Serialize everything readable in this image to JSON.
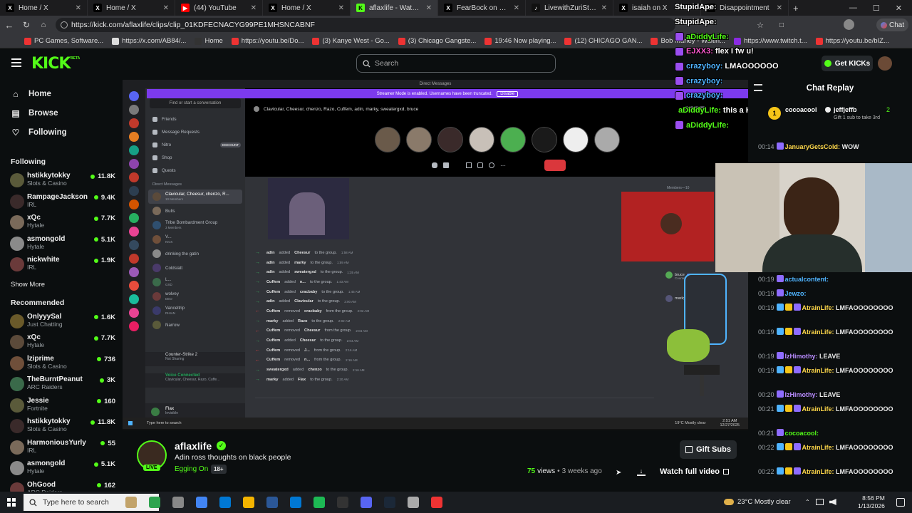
{
  "browser": {
    "tabs": [
      {
        "label": "Home / X",
        "icon": "x-logo-icon"
      },
      {
        "label": "Home / X",
        "icon": "x-logo-icon"
      },
      {
        "label": "(44) YouTube",
        "icon": "youtube-icon"
      },
      {
        "label": "Home / X",
        "icon": "x-logo-icon"
      },
      {
        "label": "aflaxlife - Watch clips o",
        "icon": "kick-icon"
      },
      {
        "label": "FearBock on X: \"LMAO t",
        "icon": "x-logo-icon"
      },
      {
        "label": "LivewithZuriStarr (@live",
        "icon": "tiktok-icon"
      },
      {
        "label": "isaiah on X",
        "icon": "x-logo-icon"
      },
      {
        "label": "Disappointment",
        "icon": "x-logo-icon"
      }
    ],
    "url": "https://kick.com/aflaxlife/clips/clip_01KDFECNACYG99PE1MHSNCABNF",
    "profile_label": "Chat",
    "bookmarks": [
      "PC Games, Software...",
      "https://x.com/AB84/...",
      "Home",
      "https://youtu.be/Do...",
      "(3) Kanye West - Go...",
      "(3) Chicago Gangste...",
      "19:46 Now playing...",
      "(12) CHICAGO GAN...",
      "Bob Marley - Waitin...",
      "https://www.twitch.t...",
      "https://youtu.be/bIZ..."
    ]
  },
  "header": {
    "logo": "KICK",
    "logo_beta": "BETA",
    "search_placeholder": "Search",
    "get_kicks": "Get KICKs",
    "accent": "#53fc18"
  },
  "sidebar": {
    "nav": [
      {
        "label": "Home",
        "icon": "home-icon"
      },
      {
        "label": "Browse",
        "icon": "browse-icon"
      },
      {
        "label": "Following",
        "icon": "heart-icon"
      }
    ],
    "following_title": "Following",
    "following": [
      {
        "name": "hstikkytokky",
        "category": "Slots & Casino",
        "viewers": "11.8K"
      },
      {
        "name": "RampageJackson",
        "category": "IRL",
        "viewers": "9.4K"
      },
      {
        "name": "xQc",
        "category": "Hytale",
        "viewers": "7.7K"
      },
      {
        "name": "asmongold",
        "category": "Hytale",
        "viewers": "5.1K"
      },
      {
        "name": "nickwhite",
        "category": "IRL",
        "viewers": "1.9K"
      }
    ],
    "show_more": "Show More",
    "recommended_title": "Recommended",
    "recommended": [
      {
        "name": "OnlyyySal",
        "category": "Just Chatting",
        "viewers": "1.6K"
      },
      {
        "name": "xQc",
        "category": "Hytale",
        "viewers": "7.7K"
      },
      {
        "name": "lziprime",
        "category": "Slots & Casino",
        "viewers": "736"
      },
      {
        "name": "TheBurntPeanut",
        "category": "ARC Raiders",
        "viewers": "3K"
      },
      {
        "name": "Jessie",
        "category": "Fortnite",
        "viewers": "160"
      },
      {
        "name": "hstikkytokky",
        "category": "Slots & Casino",
        "viewers": "11.8K"
      },
      {
        "name": "HarmoniousYurly",
        "category": "IRL",
        "viewers": "55"
      },
      {
        "name": "asmongold",
        "category": "Hytale",
        "viewers": "5.1K"
      },
      {
        "name": "OhGood",
        "category": "ARC Raiders",
        "viewers": "162"
      }
    ]
  },
  "video": {
    "title_bar": "Direct Messages",
    "banner": "Streamer Mode is enabled. Usernames have been truncated.",
    "banner_btn": "Disable",
    "find_conv": "Find or start a conversation",
    "dm_header": "Clavicular, Cheesur, chenzo, Razo, Cuffem, adin, marky, sweatergxd, bruce",
    "enabled_badge": "ENABLED",
    "dm_nav": [
      "Friends",
      "Message Requests",
      "Nitro",
      "Shop",
      "Quests"
    ],
    "nitro_badge": "DISCOUNT",
    "dm_section": "Direct Messages",
    "dm_list": [
      {
        "name": "Clavicular, Cheesur, chenzo, R...",
        "sub": "10 Members"
      },
      {
        "name": "Bulls",
        "sub": ""
      },
      {
        "name": "Tribe Bombardment Group",
        "sub": "3 Members"
      },
      {
        "name": "V...",
        "sub": "KICK"
      },
      {
        "name": "drinking the gatin",
        "sub": ""
      },
      {
        "name": "Coldslatt",
        "sub": ""
      },
      {
        "name": "L...",
        "sub": "GXD"
      },
      {
        "name": "wolvey",
        "sub": "DEO"
      },
      {
        "name": "Vanceltrip",
        "sub": "RHIAN"
      },
      {
        "name": "Narrow",
        "sub": ""
      }
    ],
    "game": "Counter-Strike 2",
    "game_sub": "Not Sharing",
    "voice": "Voice Connected",
    "voice_sub": "Clavicular, Cheesur, Razo, Cuffe...",
    "user": "Flax",
    "user_sub": "Invisible",
    "members_label": "Members—10",
    "messages": [
      {
        "dir": "in",
        "user": "adin",
        "action": "added",
        "target": "Cheesur",
        "rest": "to the group.",
        "time": "1:58 AM"
      },
      {
        "dir": "in",
        "user": "adin",
        "action": "added",
        "target": "marky",
        "rest": "to the group.",
        "time": "1:59 AM"
      },
      {
        "dir": "in",
        "user": "adin",
        "action": "added",
        "target": "sweatergxd",
        "rest": "to the group.",
        "time": "1:35 AM"
      },
      {
        "dir": "in",
        "user": "Cuffem",
        "action": "added",
        "target": "n...",
        "rest": "to the group.",
        "time": "1:43 AM"
      },
      {
        "dir": "in",
        "user": "Cuffem",
        "action": "added",
        "target": "cracbaby",
        "rest": "to the group.",
        "time": "1:45 AM"
      },
      {
        "dir": "in",
        "user": "adin",
        "action": "added",
        "target": "Clavicular",
        "rest": "to the group.",
        "time": "2:00 AM"
      },
      {
        "dir": "out",
        "user": "Cuffem",
        "action": "removed",
        "target": "cracbaby",
        "rest": "from the group.",
        "time": "2:02 AM"
      },
      {
        "dir": "in",
        "user": "marky",
        "action": "added",
        "target": "Razo",
        "rest": "to the group.",
        "time": "2:02 AM"
      },
      {
        "dir": "out",
        "user": "Cuffem",
        "action": "removed",
        "target": "Cheesur",
        "rest": "from the group.",
        "time": "2:04 AM"
      },
      {
        "dir": "in",
        "user": "Cuffem",
        "action": "added",
        "target": "Cheesur",
        "rest": "to the group.",
        "time": "2:04 AM"
      },
      {
        "dir": "out",
        "user": "Cuffem",
        "action": "removed",
        "target": "J...",
        "rest": "from the group.",
        "time": "2:16 AM"
      },
      {
        "dir": "out",
        "user": "Cuffem",
        "action": "removed",
        "target": "n...",
        "rest": "from the group.",
        "time": "2:16 AM"
      },
      {
        "dir": "in",
        "user": "sweatergxd",
        "action": "added",
        "target": "chenzo",
        "rest": "to the group.",
        "time": "2:16 AM"
      },
      {
        "dir": "in",
        "user": "marky",
        "action": "added",
        "target": "Flax",
        "rest": "to the group.",
        "time": "2:20 AM"
      }
    ],
    "taskbar_search": "Type here to search",
    "weather": "19°C  Mostly clear",
    "time": "2:51 AM",
    "date": "12/27/2025",
    "member_names": [
      "bruce",
      "marky"
    ],
    "member_tags": [
      "DEO",
      "Counter-Strike 2"
    ]
  },
  "overlay_chat": [
    {
      "user": "StupidApe:",
      "text": "",
      "color": "#fff"
    },
    {
      "user": "StupidApe:",
      "text": "",
      "color": "#fff"
    },
    {
      "user": "aDiddyLife:",
      "text": "",
      "color": "#53fc18"
    },
    {
      "user": "EJXX3:",
      "text": "flex I fw u!",
      "color": "#ff5ad1"
    },
    {
      "user": "crazyboy:",
      "text": "LMAOOOOOO",
      "color": "#4fb4ff"
    },
    {
      "user": "crazyboy:",
      "text": "",
      "color": "#4fb4ff"
    },
    {
      "user": "crazyboy:",
      "text": "",
      "color": "#4fb4ff"
    },
    {
      "user": "aDiddyLife:",
      "text": "this a HOF clip from now on",
      "color": "#53fc18"
    },
    {
      "user": "aDiddyLife:",
      "text": "",
      "color": "#53fc18"
    }
  ],
  "chat": {
    "title": "Chat Replay",
    "gift_user": "cocoacool",
    "gift_target": "jeffjeffb",
    "gift_count": "2",
    "gift_text": "Gift 1 sub to take 3rd",
    "messages": [
      {
        "time": "00:14",
        "user": "JanuaryGetsCold:",
        "text": "WOW",
        "color": "#ffd84a"
      },
      {
        "time": "00:19",
        "user": "actualcontent:",
        "text": "",
        "color": "#4fb4ff"
      },
      {
        "time": "00:19",
        "user": "Jewzo:",
        "text": "",
        "color": "#4fb4ff"
      },
      {
        "time": "00:19",
        "user": "AtrainLife:",
        "text": "LMFAOOOOOOOO",
        "color": "#ffd84a"
      },
      {
        "time": "00:19",
        "user": "AtrainLife:",
        "text": "LMFAOOOOOOOO",
        "color": "#ffd84a"
      },
      {
        "time": "00:19",
        "user": "IzHimothy:",
        "text": "LEAVE",
        "color": "#b98cff"
      },
      {
        "time": "00:19",
        "user": "AtrainLife:",
        "text": "LMFAOOOOOOOO",
        "color": "#ffd84a"
      },
      {
        "time": "00:20",
        "user": "IzHimothy:",
        "text": "LEAVE",
        "color": "#b98cff"
      },
      {
        "time": "00:21",
        "user": "AtrainLife:",
        "text": "LMFAOOOOOOOO",
        "color": "#ffd84a"
      },
      {
        "time": "00:21",
        "user": "cocoacool:",
        "text": "",
        "color": "#53fc18"
      },
      {
        "time": "00:22",
        "user": "AtrainLife:",
        "text": "LMFAOOOOOOOO",
        "color": "#ffd84a"
      },
      {
        "time": "00:22",
        "user": "AtrainLife:",
        "text": "LMFAOOOOOOOO",
        "color": "#ffd84a"
      }
    ]
  },
  "clip": {
    "channel": "aflaxlife",
    "title": "Adin ross thoughts on black people",
    "category": "Egging On",
    "rating": "18+",
    "live": "LIVE",
    "views": "75",
    "views_label": "views",
    "age": "3 weeks ago",
    "gift_subs": "Gift Subs",
    "watch_full": "Watch full video"
  },
  "taskbar": {
    "search": "Type here to search",
    "weather": "23°C  Mostly clear",
    "time": "8:56 PM",
    "date": "1/13/2026"
  }
}
